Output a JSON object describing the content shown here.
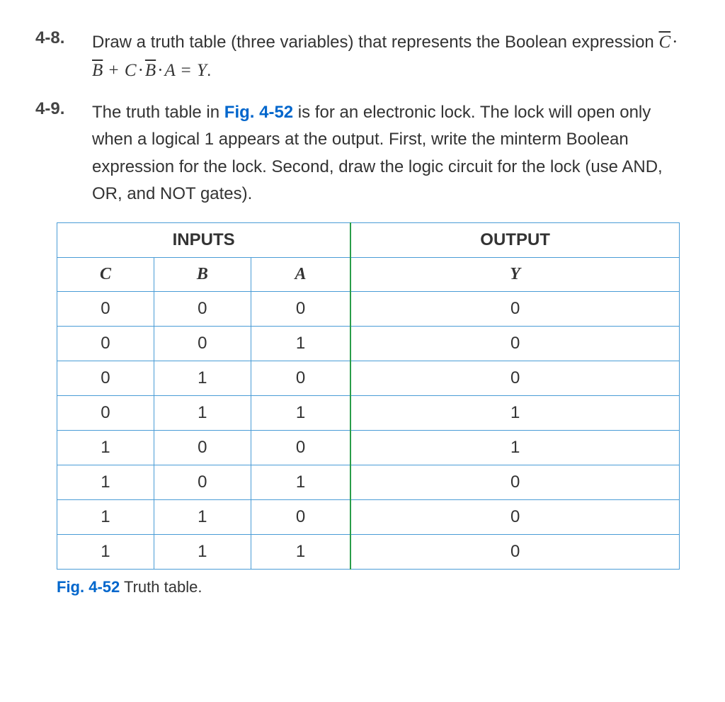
{
  "problems": {
    "p48": {
      "number": "4-8.",
      "text_pre": "Draw a truth table (three variables) that represents the Boolean expression ",
      "expr": {
        "t1a": "C",
        "t1b": "B",
        "plus": "+",
        "t2a": "C",
        "t2b": "B",
        "t2c": "A",
        "eq": "=",
        "rhs": "Y",
        "dot": "·"
      },
      "text_post": "."
    },
    "p49": {
      "number": "4-9.",
      "text_a": "The truth table in ",
      "fig_ref": "Fig. 4-52",
      "text_b": " is for an electronic lock. The lock will open only when a logical 1 appears at the output. First, write the minterm Boolean expression for the lock. Second, draw the logic circuit for the lock (use AND, OR, and NOT gates)."
    }
  },
  "table": {
    "header_inputs": "INPUTS",
    "header_output": "OUTPUT",
    "cols": {
      "c0": "C",
      "c1": "B",
      "c2": "A",
      "c3": "Y"
    },
    "rows": [
      {
        "c": "0",
        "b": "0",
        "a": "0",
        "y": "0"
      },
      {
        "c": "0",
        "b": "0",
        "a": "1",
        "y": "0"
      },
      {
        "c": "0",
        "b": "1",
        "a": "0",
        "y": "0"
      },
      {
        "c": "0",
        "b": "1",
        "a": "1",
        "y": "1"
      },
      {
        "c": "1",
        "b": "0",
        "a": "0",
        "y": "1"
      },
      {
        "c": "1",
        "b": "0",
        "a": "1",
        "y": "0"
      },
      {
        "c": "1",
        "b": "1",
        "a": "0",
        "y": "0"
      },
      {
        "c": "1",
        "b": "1",
        "a": "1",
        "y": "0"
      }
    ]
  },
  "caption": {
    "fig": "Fig. 4-52",
    "text": "  Truth table."
  },
  "chart_data": {
    "type": "table",
    "title": "Fig. 4-52 Truth table",
    "columns": [
      "C",
      "B",
      "A",
      "Y"
    ],
    "rows": [
      [
        0,
        0,
        0,
        0
      ],
      [
        0,
        0,
        1,
        0
      ],
      [
        0,
        1,
        0,
        0
      ],
      [
        0,
        1,
        1,
        1
      ],
      [
        1,
        0,
        0,
        1
      ],
      [
        1,
        0,
        1,
        0
      ],
      [
        1,
        1,
        0,
        0
      ],
      [
        1,
        1,
        1,
        0
      ]
    ],
    "input_columns": [
      "C",
      "B",
      "A"
    ],
    "output_columns": [
      "Y"
    ]
  }
}
